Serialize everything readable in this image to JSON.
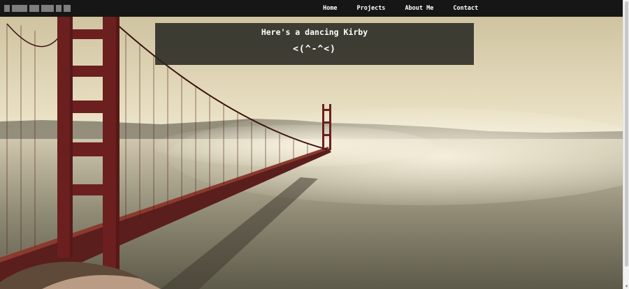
{
  "navbar": {
    "brand": "",
    "links": [
      {
        "label": "Home"
      },
      {
        "label": "Projects"
      },
      {
        "label": "About Me"
      },
      {
        "label": "Contact"
      }
    ]
  },
  "banner": {
    "headline": "Here's a dancing Kirby",
    "kirby": "<(^-^<)"
  },
  "background": {
    "subject": "golden-gate-bridge-photo",
    "tint": "#d9cfae",
    "tower_color": "#6b1f1f"
  },
  "icons": {
    "scroll_up": "arrow-up-icon",
    "scroll_down": "arrow-down-icon"
  }
}
